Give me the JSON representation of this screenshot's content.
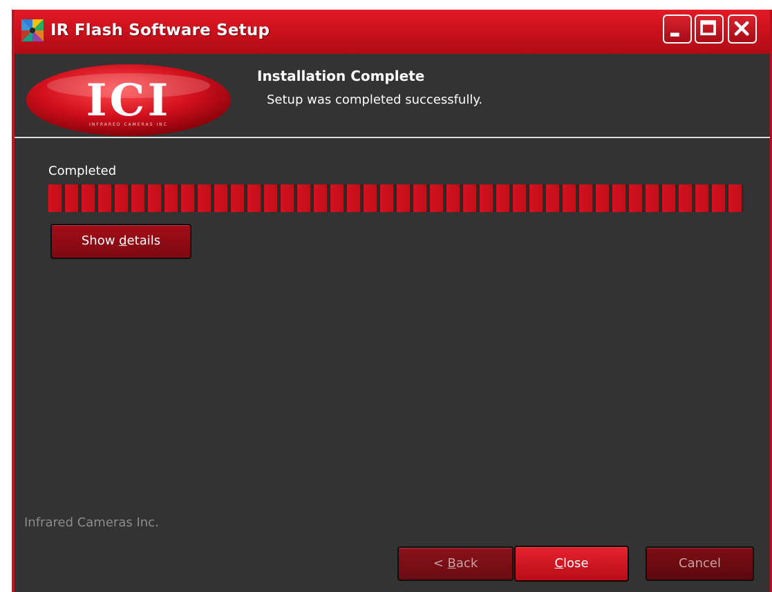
{
  "window": {
    "title": "IR Flash Software Setup",
    "icons": {
      "app": "setup-icon",
      "minimize": "minimize-icon",
      "maximize": "maximize-icon",
      "close": "close-icon"
    }
  },
  "header": {
    "logo_text": "ICI",
    "logo_subtext": "INFRARED CAMERAS INC",
    "title": "Installation Complete",
    "subtitle": "Setup was completed successfully."
  },
  "progress": {
    "label": "Completed",
    "percent": 100
  },
  "buttons": {
    "show_details": {
      "before": "Show ",
      "accel": "d",
      "after": "etails"
    },
    "back": {
      "before": "< ",
      "accel": "B",
      "after": "ack"
    },
    "close": {
      "before": "",
      "accel": "C",
      "after": "lose"
    },
    "cancel": "Cancel"
  },
  "footer": {
    "brand": "Infrared Cameras Inc."
  },
  "colors": {
    "accent": "#c7101b",
    "background": "#333333",
    "text": "#ffffff",
    "muted_text": "#8c8c8c"
  }
}
